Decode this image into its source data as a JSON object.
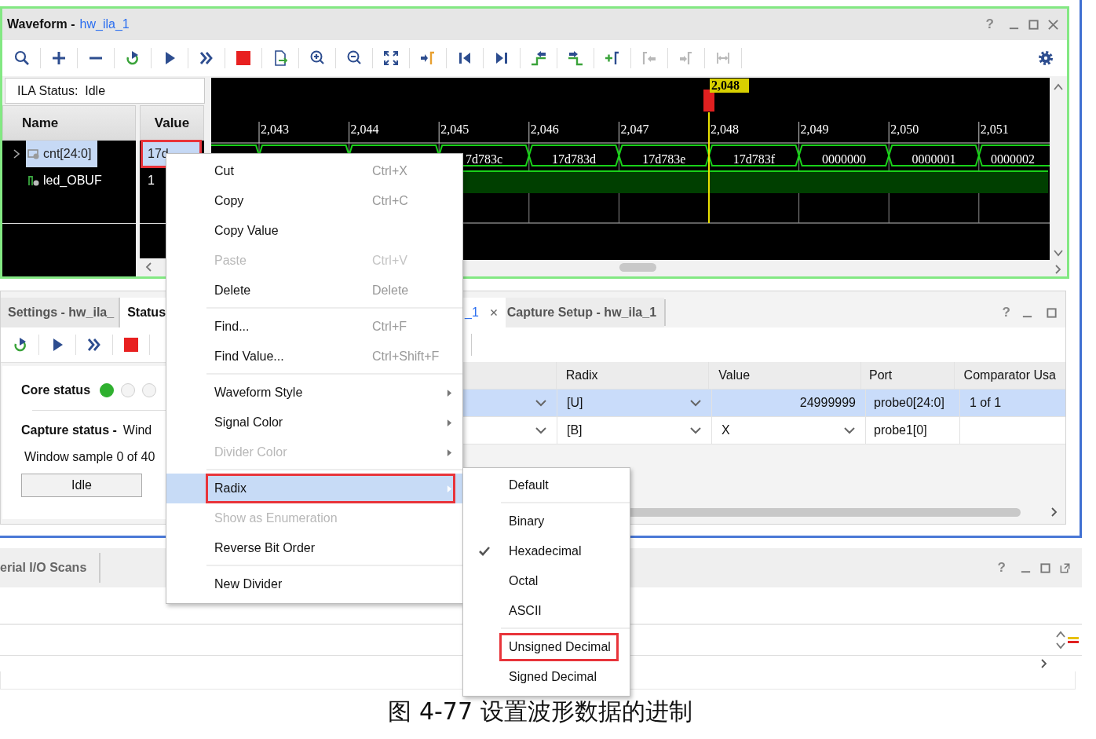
{
  "waveform_panel": {
    "title": "Waveform -",
    "link": "hw_ila_1",
    "help": "?",
    "toolbar": [
      {
        "kind": "search",
        "disabled": false
      },
      {
        "kind": "add",
        "disabled": false
      },
      {
        "kind": "remove",
        "disabled": false
      },
      {
        "kind": "rerun",
        "disabled": false
      },
      {
        "kind": "run",
        "disabled": false
      },
      {
        "kind": "run-all",
        "disabled": false
      },
      {
        "kind": "stop",
        "disabled": false
      },
      {
        "kind": "export",
        "disabled": false
      },
      {
        "kind": "zoom-in",
        "disabled": false
      },
      {
        "kind": "zoom-out",
        "disabled": false
      },
      {
        "kind": "fit",
        "disabled": false
      },
      {
        "kind": "goto-cursor",
        "disabled": false
      },
      {
        "kind": "prev-edge",
        "disabled": false
      },
      {
        "kind": "next-edge",
        "disabled": false
      },
      {
        "kind": "prev-transition",
        "disabled": false
      },
      {
        "kind": "next-transition",
        "disabled": false
      },
      {
        "kind": "add-marker",
        "disabled": false
      },
      {
        "kind": "prev-marker",
        "disabled": true
      },
      {
        "kind": "next-marker",
        "disabled": true
      },
      {
        "kind": "swap-markers",
        "disabled": true
      }
    ],
    "ila_status": "ILA Status:  Idle",
    "columns": [
      "Name",
      "Value"
    ],
    "signals": [
      {
        "kind": "bus",
        "name": "cnt[24:0]",
        "value": "17d",
        "selected": true,
        "outlined": true,
        "wave_values": [
          "7d783c",
          "17d783d",
          "17d783e",
          "17d783f",
          "0000000",
          "0000001",
          "0000002"
        ]
      },
      {
        "kind": "bit",
        "name": "led_OBUF",
        "value": "1",
        "selected": false,
        "outlined": false
      }
    ],
    "ticks": [
      {
        "label": "2,043",
        "cursor": false
      },
      {
        "label": "2,044",
        "cursor": false
      },
      {
        "label": "2,045",
        "cursor": false
      },
      {
        "label": "2,046",
        "cursor": false
      },
      {
        "label": "2,047",
        "cursor": false
      },
      {
        "label": "2,048",
        "cursor": true
      },
      {
        "label": "2,049",
        "cursor": false
      },
      {
        "label": "2,050",
        "cursor": false
      },
      {
        "label": "2,051",
        "cursor": false
      }
    ],
    "cursor_label": "2,048"
  },
  "settings_panel": {
    "tabs": [
      {
        "label": "Settings - hw_ila_",
        "selected": false
      },
      {
        "label": "Status",
        "selected": true
      }
    ],
    "toolbar": [
      {
        "kind": "rerun",
        "disabled": false
      },
      {
        "kind": "run",
        "disabled": false
      },
      {
        "kind": "run-all",
        "disabled": false
      },
      {
        "kind": "stop",
        "disabled": false
      }
    ],
    "core_status_label": "Core status",
    "core_lights": [
      {
        "on": true
      },
      {
        "on": false
      },
      {
        "on": false
      }
    ],
    "capture_status_label": "Capture status -",
    "capture_status_value": "Wind",
    "window_sample": "Window sample 0 of 40",
    "button": "Idle"
  },
  "capture_panel": {
    "tabs": [
      {
        "label": "_1",
        "selected": true,
        "closable": true
      },
      {
        "label": "Capture Setup - hw_ila_1",
        "selected": false,
        "closable": false
      }
    ],
    "help": "?",
    "columns": [
      "Radix",
      "Value",
      "Port",
      "Comparator Usa"
    ],
    "rows": [
      {
        "radix": "[U]",
        "value": "24999999",
        "kind": "text",
        "port": "probe0[24:0]",
        "comparator": "1 of 1",
        "selected": true
      },
      {
        "radix": "[B]",
        "value": "X",
        "kind": "dropdown",
        "port": "probe1[0]",
        "selected": false
      }
    ]
  },
  "scans_panel": {
    "tab": "erial I/O Scans",
    "help": "?"
  },
  "context_menu": {
    "items": [
      {
        "kind": "item",
        "label": "Cut",
        "shortcut": "Ctrl+X",
        "disabled": false,
        "submenu": false,
        "selected": false,
        "outlined": false
      },
      {
        "kind": "item",
        "label": "Copy",
        "shortcut": "Ctrl+C",
        "disabled": false,
        "submenu": false,
        "selected": false,
        "outlined": false
      },
      {
        "kind": "item",
        "label": "Copy Value",
        "disabled": false,
        "submenu": false,
        "selected": false,
        "outlined": false
      },
      {
        "kind": "item",
        "label": "Paste",
        "shortcut": "Ctrl+V",
        "disabled": true,
        "submenu": false,
        "selected": false,
        "outlined": false
      },
      {
        "kind": "item",
        "label": "Delete",
        "shortcut": "Delete",
        "disabled": false,
        "submenu": false,
        "selected": false,
        "outlined": false
      },
      {
        "kind": "separator"
      },
      {
        "kind": "item",
        "label": "Find...",
        "shortcut": "Ctrl+F",
        "disabled": false,
        "submenu": false,
        "selected": false,
        "outlined": false
      },
      {
        "kind": "item",
        "label": "Find Value...",
        "shortcut": "Ctrl+Shift+F",
        "disabled": false,
        "submenu": false,
        "selected": false,
        "outlined": false
      },
      {
        "kind": "separator"
      },
      {
        "kind": "item",
        "label": "Waveform Style",
        "disabled": false,
        "submenu": true,
        "selected": false,
        "outlined": false
      },
      {
        "kind": "item",
        "label": "Signal Color",
        "disabled": false,
        "submenu": true,
        "selected": false,
        "outlined": false
      },
      {
        "kind": "item",
        "label": "Divider Color",
        "disabled": true,
        "submenu": true,
        "selected": false,
        "outlined": false
      },
      {
        "kind": "separator"
      },
      {
        "kind": "item",
        "label": "Radix",
        "disabled": false,
        "submenu": true,
        "selected": true,
        "outlined": true
      },
      {
        "kind": "item",
        "label": "Show as Enumeration",
        "disabled": true,
        "submenu": false,
        "selected": false,
        "outlined": false
      },
      {
        "kind": "item",
        "label": "Reverse Bit Order",
        "disabled": false,
        "submenu": false,
        "selected": false,
        "outlined": false
      },
      {
        "kind": "separator"
      },
      {
        "kind": "item",
        "label": "New Divider",
        "disabled": false,
        "submenu": false,
        "selected": false,
        "outlined": false
      }
    ]
  },
  "radix_menu": {
    "items": [
      {
        "kind": "item",
        "label": "Default",
        "checked": false,
        "outlined": false
      },
      {
        "kind": "separator"
      },
      {
        "kind": "item",
        "label": "Binary",
        "checked": false,
        "outlined": false
      },
      {
        "kind": "item",
        "label": "Hexadecimal",
        "checked": true,
        "outlined": false
      },
      {
        "kind": "item",
        "label": "Octal",
        "checked": false,
        "outlined": false
      },
      {
        "kind": "item",
        "label": "ASCII",
        "checked": false,
        "outlined": false
      },
      {
        "kind": "separator"
      },
      {
        "kind": "item",
        "label": "Unsigned Decimal",
        "checked": false,
        "outlined": true
      },
      {
        "kind": "item",
        "label": "Signed Decimal",
        "checked": false,
        "outlined": false
      }
    ]
  },
  "caption": "图 4-77 设置波形数据的进制"
}
